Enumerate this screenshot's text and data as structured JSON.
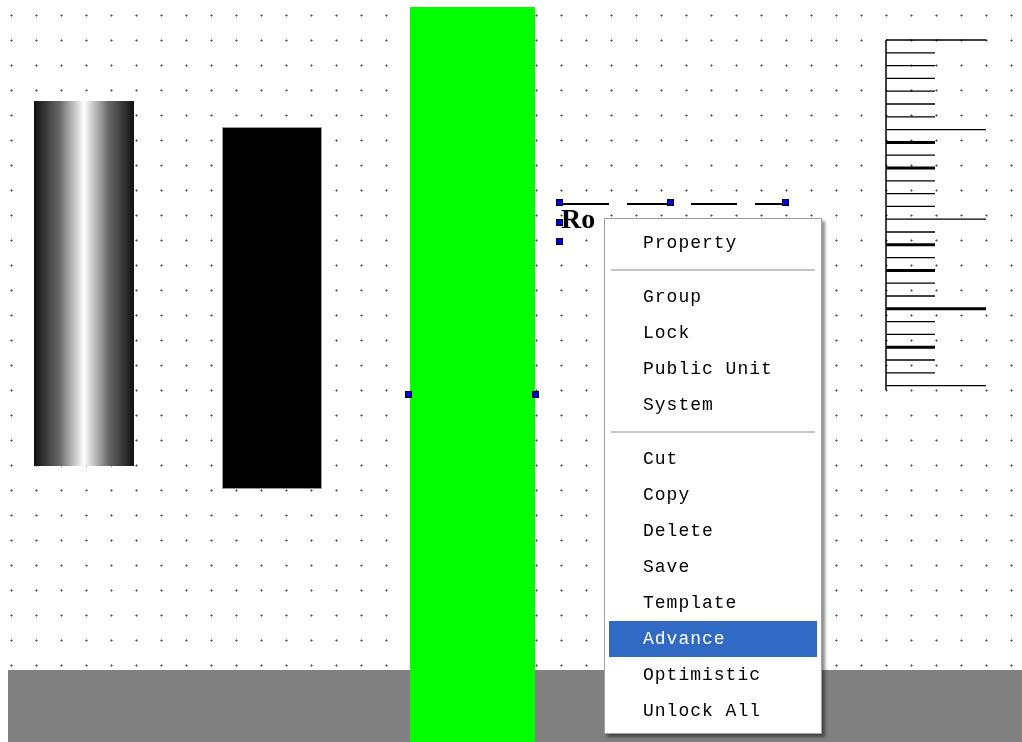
{
  "canvas": {
    "text_object": "Ro"
  },
  "context_menu": {
    "items": [
      {
        "kind": "item",
        "label": "Property",
        "selected": false
      },
      {
        "kind": "separator"
      },
      {
        "kind": "item",
        "label": "Group",
        "selected": false
      },
      {
        "kind": "item",
        "label": "Lock",
        "selected": false
      },
      {
        "kind": "item",
        "label": "Public Unit",
        "selected": false
      },
      {
        "kind": "item",
        "label": "System",
        "selected": false
      },
      {
        "kind": "separator"
      },
      {
        "kind": "item",
        "label": "Cut",
        "selected": false
      },
      {
        "kind": "item",
        "label": "Copy",
        "selected": false
      },
      {
        "kind": "item",
        "label": "Delete",
        "selected": false
      },
      {
        "kind": "item",
        "label": "Save",
        "selected": false
      },
      {
        "kind": "item",
        "label": "Template",
        "selected": false
      },
      {
        "kind": "item",
        "label": "Advance",
        "selected": true
      },
      {
        "kind": "item",
        "label": "Optimistic",
        "selected": false
      },
      {
        "kind": "item",
        "label": "Unlock All",
        "selected": false
      }
    ]
  }
}
